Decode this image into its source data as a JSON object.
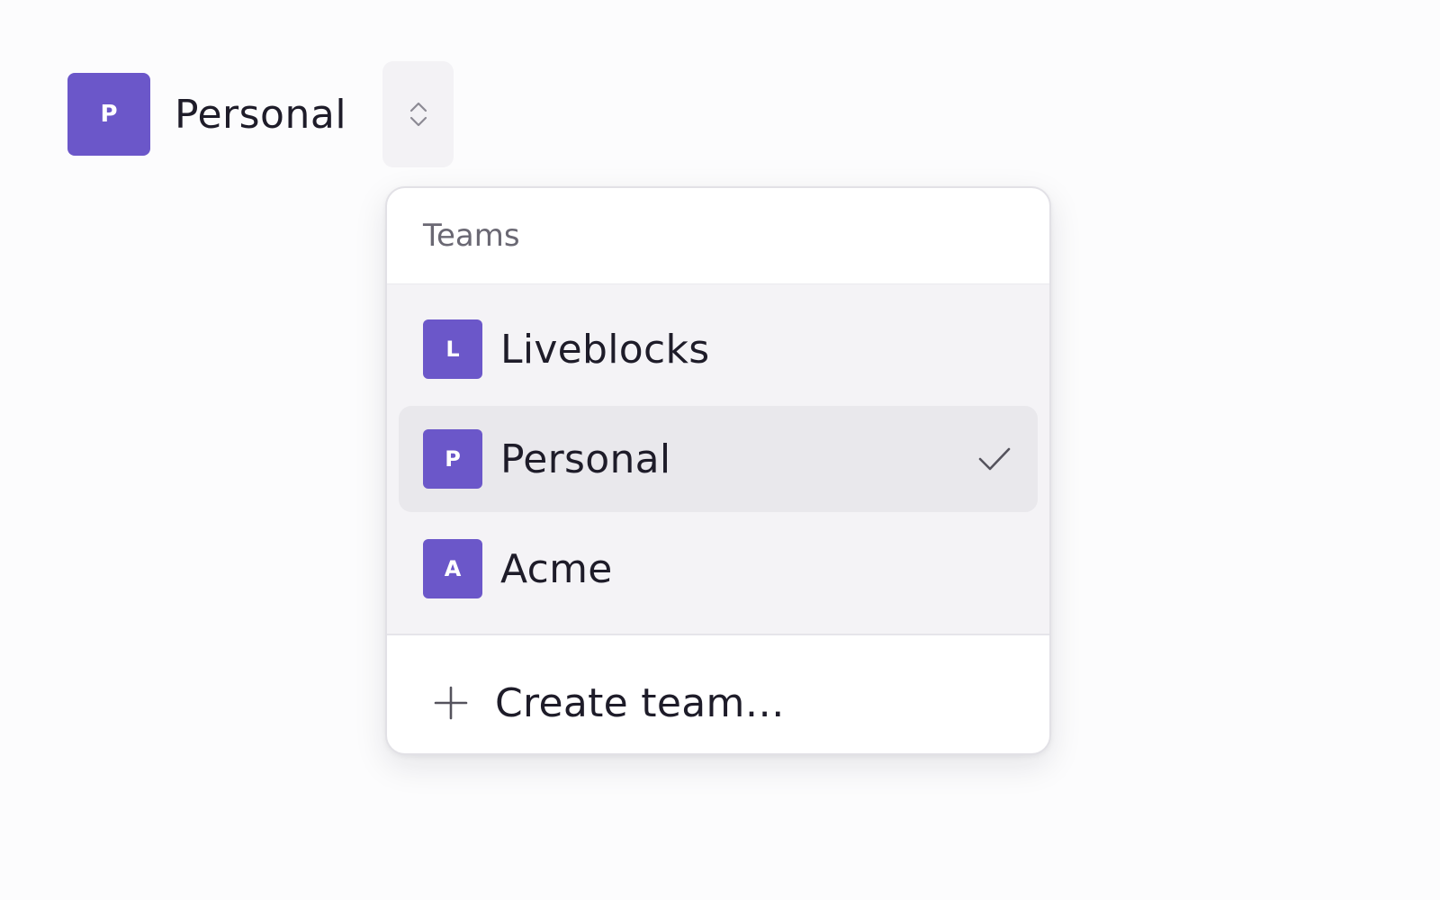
{
  "current_team": {
    "initial": "P",
    "name": "Personal"
  },
  "menu": {
    "header": "Teams",
    "teams": [
      {
        "initial": "L",
        "name": "Liveblocks",
        "selected": false
      },
      {
        "initial": "P",
        "name": "Personal",
        "selected": true
      },
      {
        "initial": "A",
        "name": "Acme",
        "selected": false
      }
    ],
    "create_label": "Create team…"
  },
  "colors": {
    "accent": "#6b57c9",
    "background": "#fcfcfd",
    "list_background": "#f4f3f6",
    "selected_background": "#e9e8ec",
    "text": "#1e1c29",
    "muted_text": "#6a6873"
  },
  "icons": {
    "toggle": "chevron-up-down-icon",
    "selected": "check-icon",
    "create": "plus-icon"
  }
}
